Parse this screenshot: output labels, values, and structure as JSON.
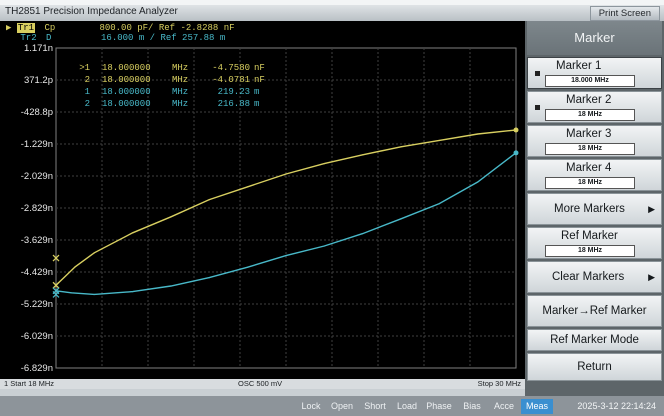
{
  "title_bar": {
    "title": "TH2851 Precision Impedance Analyzer",
    "print_screen": "Print Screen"
  },
  "trace_header": {
    "tr1": {
      "name": "Tr1",
      "param": "Cp",
      "value": "800.00",
      "unit": "pF/",
      "ref": "Ref -2.8288",
      "ref_unit": "nF"
    },
    "tr2": {
      "name": "Tr2",
      "param": "D",
      "value": "16.000",
      "unit": "m /",
      "ref": "Ref 257.88",
      "ref_unit": "m"
    }
  },
  "marker_readout": [
    {
      "prefix": ">1",
      "freq": "18.000000",
      "unit": "MHz",
      "value": "-4.7580",
      "vunit": "nF",
      "trace": "tr1"
    },
    {
      "prefix": "2",
      "freq": "18.000000",
      "unit": "MHz",
      "value": "-4.0781",
      "vunit": "nF",
      "trace": "tr1"
    },
    {
      "prefix": "1",
      "freq": "18.000000",
      "unit": "MHz",
      "value": "219.23",
      "vunit": "m",
      "trace": "tr2"
    },
    {
      "prefix": "2",
      "freq": "18.000000",
      "unit": "MHz",
      "value": "216.88",
      "vunit": "m",
      "trace": "tr2"
    }
  ],
  "y_axis_labels": [
    "1.171n",
    "371.2p",
    "-428.8p",
    "-1.229n",
    "-2.029n",
    "-2.829n",
    "-3.629n",
    "-4.429n",
    "-5.229n",
    "-6.029n",
    "-6.829n"
  ],
  "status_strip": {
    "start": "1 Start 18 MHz",
    "osc": "OSC 500 mV",
    "stop": "Stop 30 MHz"
  },
  "chart_data": {
    "type": "line",
    "x_range_mhz": [
      18,
      30
    ],
    "ylim": [
      -6.829,
      1.171
    ],
    "y_unit": "nF",
    "series": [
      {
        "name": "Tr1",
        "color": "#d8cf60",
        "x": [
          18,
          18.5,
          19,
          20,
          21,
          22,
          23,
          24,
          25,
          26,
          27,
          28,
          29,
          30
        ],
        "y": [
          -4.76,
          -4.3,
          -3.95,
          -3.45,
          -3.05,
          -2.62,
          -2.3,
          -1.98,
          -1.72,
          -1.5,
          -1.3,
          -1.14,
          -0.98,
          -0.88
        ]
      },
      {
        "name": "Tr2",
        "color": "#48b8c8",
        "x": [
          18,
          18.4,
          19,
          20,
          21,
          22,
          23,
          24,
          25,
          26,
          27,
          28,
          29,
          30
        ],
        "y": [
          -4.9,
          -4.95,
          -4.99,
          -4.92,
          -4.78,
          -4.57,
          -4.31,
          -4.02,
          -3.78,
          -3.47,
          -3.1,
          -2.72,
          -2.18,
          -1.45
        ]
      }
    ]
  },
  "side_panel": {
    "title": "Marker",
    "marker1": {
      "label": "Marker 1",
      "value": "18.000 MHz"
    },
    "marker2": {
      "label": "Marker 2",
      "value": "18 MHz"
    },
    "marker3": {
      "label": "Marker 3",
      "value": "18 MHz"
    },
    "marker4": {
      "label": "Marker 4",
      "value": "18 MHz"
    },
    "more_markers": "More Markers",
    "ref_marker": {
      "label": "Ref Marker",
      "value": "18 MHz"
    },
    "clear_markers": "Clear Markers",
    "marker_to_ref": "Marker→Ref Marker",
    "ref_marker_mode": "Ref Marker Mode",
    "return_label": "Return"
  },
  "bottom_bar": {
    "lock": "Lock",
    "open": "Open",
    "short": "Short",
    "load": "Load",
    "phase": "Phase",
    "bias": "Bias",
    "acce": "Acce",
    "meas": "Meas",
    "datetime": "2025-3-12 22:14:24"
  }
}
